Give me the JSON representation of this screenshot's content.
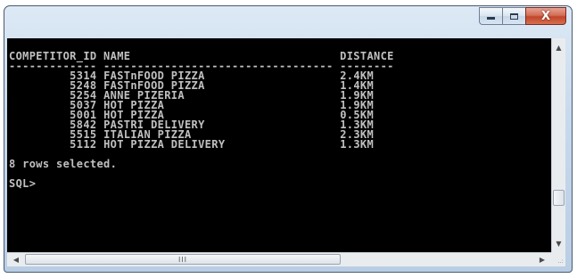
{
  "window": {
    "minimize_label": "Minimize",
    "maximize_label": "Maximize",
    "close_glyph": "X"
  },
  "console": {
    "header": "COMPETITOR_ID NAME                               DISTANCE",
    "separator": "------------- ---------------------------------- --------",
    "rows": [
      {
        "competitor_id": "5314",
        "name": "FASTnFOOD PIZZA",
        "distance": "2.4KM"
      },
      {
        "competitor_id": "5248",
        "name": "FASTnFOOD PIZZA",
        "distance": "1.4KM"
      },
      {
        "competitor_id": "5254",
        "name": "ANNE PIZERIA",
        "distance": "1.9KM"
      },
      {
        "competitor_id": "5037",
        "name": "HOT PIZZA",
        "distance": "1.9KM"
      },
      {
        "competitor_id": "5001",
        "name": "HOT PIZZA",
        "distance": "0.5KM"
      },
      {
        "competitor_id": "5842",
        "name": "PASTRI DELIVERY",
        "distance": "1.3KM"
      },
      {
        "competitor_id": "5515",
        "name": "ITALIAN PIZZA",
        "distance": "2.3KM"
      },
      {
        "competitor_id": "5112",
        "name": "HOT PIZZA DELIVERY",
        "distance": "1.3KM"
      }
    ],
    "summary": "8 rows selected.",
    "prompt": "SQL>"
  },
  "scrollbars": {
    "up_arrow": "▲",
    "down_arrow": "▼",
    "left_arrow": "◀",
    "right_arrow": "▶",
    "hthumb_grip": "III",
    "size_grip": "..:"
  },
  "colors": {
    "console_bg": "#000000",
    "console_text": "#c0c0c0",
    "close_button": "#c2452b"
  }
}
